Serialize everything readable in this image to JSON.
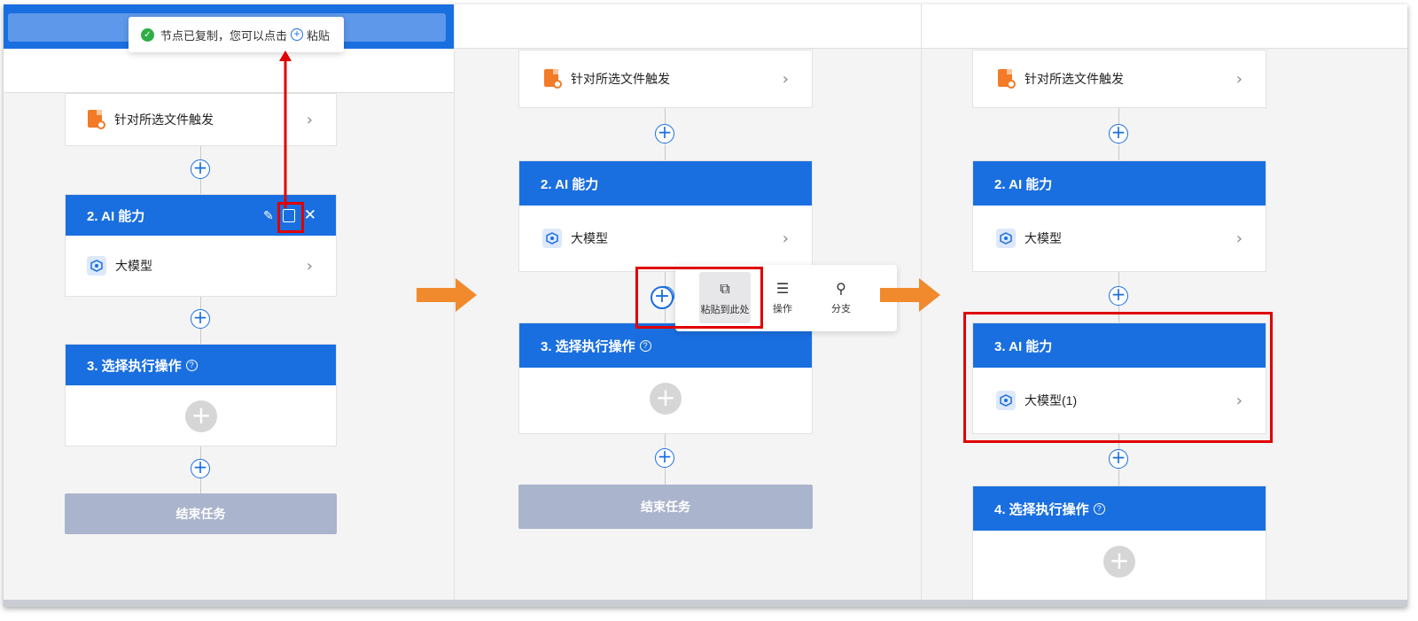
{
  "toast": {
    "text_before": "节点已复制，您可以点击",
    "icon": "plus-circle-icon",
    "text_after": "粘贴",
    "ok_icon": "check-circle-icon"
  },
  "panel1": {
    "trigger_label": "针对所选文件触发",
    "node2": {
      "title": "2. AI 能力",
      "item": "大模型",
      "tools": [
        "edit-icon",
        "copy-icon",
        "close-icon"
      ]
    },
    "node3": {
      "title": "3. 选择执行操作"
    },
    "end_label": "结束任务"
  },
  "panel2": {
    "trigger_label": "针对所选文件触发",
    "node2": {
      "title": "2. AI 能力",
      "item": "大模型"
    },
    "menu": {
      "paste": "粘贴到此处",
      "action": "操作",
      "branch": "分支"
    },
    "node3": {
      "title": "3. 选择执行操作"
    },
    "end_label": "结束任务"
  },
  "panel3": {
    "trigger_label": "针对所选文件触发",
    "node2": {
      "title": "2. AI 能力",
      "item": "大模型"
    },
    "node3": {
      "title": "3. AI 能力",
      "item": "大模型(1)"
    },
    "node4": {
      "title": "4. 选择执行操作"
    }
  },
  "colors": {
    "primary": "#1a6fe0",
    "highlight": "#e00000",
    "arrow": "#f08a2c",
    "end_button": "#aab4cc"
  }
}
